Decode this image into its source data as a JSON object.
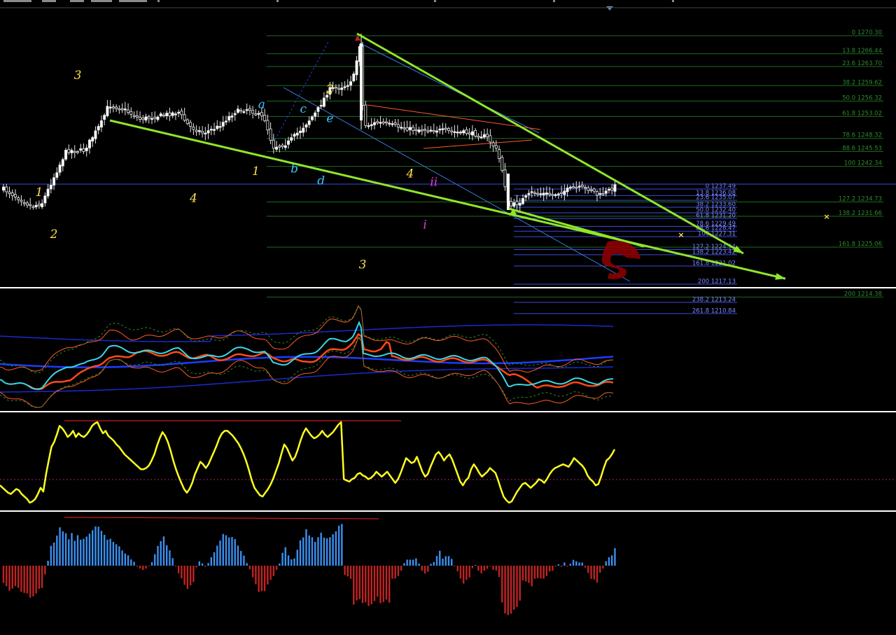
{
  "colors": {
    "background": "#000000",
    "fib_main": "#1f6b1f",
    "fib_main_text": "#2e8b2e",
    "fib_sub": "#3a4bd8",
    "fib_sub_text": "#7d86ff",
    "trend": "#8ee62a",
    "wave_yellow": "#ffe14a",
    "wave_cyan": "#3ec3ff",
    "wave_magenta": "#e03ce6",
    "bull_candle": "#ffffff",
    "bear_candle": "#000000",
    "wick": "#e8e8e8",
    "osc_line": "#ffff1e",
    "hist_up": "#3a8ff0",
    "hist_down": "#c02323",
    "divergence": "#ff2020",
    "marker": "#ffe14a"
  },
  "fib_main_levels": [
    {
      "label": "0 1270.30",
      "price": 1270.3
    },
    {
      "label": "13.8 1266.44",
      "price": 1266.44
    },
    {
      "label": "23.6 1263.70",
      "price": 1263.7
    },
    {
      "label": "38.2 1259.62",
      "price": 1259.62
    },
    {
      "label": "50.0 1256.32",
      "price": 1256.32
    },
    {
      "label": "61.8 1253.02",
      "price": 1253.02
    },
    {
      "label": "78.6 1248.32",
      "price": 1248.32
    },
    {
      "label": "88.6 1245.53",
      "price": 1245.53
    },
    {
      "label": "100 1242.34",
      "price": 1242.34
    },
    {
      "label": "127.2 1234.73",
      "price": 1234.73
    },
    {
      "label": "138.2 1231.66",
      "price": 1231.66
    },
    {
      "label": "161.8 1225.06",
      "price": 1225.06
    },
    {
      "label": "200 1214.38",
      "price": 1214.38
    }
  ],
  "fib_sub_levels": [
    {
      "label": "0 1237.49",
      "price": 1237.49
    },
    {
      "label": "13.8 1236.08",
      "price": 1236.08
    },
    {
      "label": "23.6 1235.07",
      "price": 1235.07
    },
    {
      "label": "38.2 1233.60",
      "price": 1233.6
    },
    {
      "label": "50.0 1232.40",
      "price": 1232.4
    },
    {
      "label": "61.8 1231.20",
      "price": 1231.2
    },
    {
      "label": "78.6 1229.49",
      "price": 1229.49
    },
    {
      "label": "88.6 1228.47",
      "price": 1228.47
    },
    {
      "label": "100 1227.31",
      "price": 1227.31
    },
    {
      "label": "127.2 1224.54",
      "price": 1224.54
    },
    {
      "label": "138.2 1223.42",
      "price": 1223.42
    },
    {
      "label": "161.8 1221.02",
      "price": 1221.02
    },
    {
      "label": "200 1217.13",
      "price": 1217.13
    },
    {
      "label": "238.2 1213.24",
      "price": 1213.24
    },
    {
      "label": "261.8 1210.84",
      "price": 1210.84
    }
  ],
  "wave_labels": [
    {
      "text": "1",
      "bar": 12,
      "price": 1236.0,
      "color": "wave_yellow"
    },
    {
      "text": "2",
      "bar": 17,
      "price": 1227.0,
      "color": "wave_yellow"
    },
    {
      "text": "3",
      "bar": 25,
      "price": 1261.0,
      "color": "wave_yellow"
    },
    {
      "text": "4",
      "bar": 64,
      "price": 1234.7,
      "color": "wave_yellow"
    },
    {
      "text": "5",
      "bar": 85,
      "price": 1278.0,
      "color": "wave_yellow"
    },
    {
      "text": "1",
      "bar": 85,
      "price": 1240.5,
      "color": "wave_yellow"
    },
    {
      "text": "2",
      "bar": 110,
      "price": 1258.0,
      "color": "wave_yellow"
    },
    {
      "text": "3",
      "bar": 121,
      "price": 1220.5,
      "color": "wave_yellow"
    },
    {
      "text": "4",
      "bar": 137,
      "price": 1240.0,
      "color": "wave_yellow"
    },
    {
      "text": "a",
      "bar": 87,
      "price": 1254.8,
      "color": "wave_cyan"
    },
    {
      "text": "b",
      "bar": 98,
      "price": 1241.0,
      "color": "wave_cyan"
    },
    {
      "text": "c",
      "bar": 101,
      "price": 1253.8,
      "color": "wave_cyan"
    },
    {
      "text": "d",
      "bar": 107,
      "price": 1238.5,
      "color": "wave_cyan"
    },
    {
      "text": "e",
      "bar": 110,
      "price": 1251.8,
      "color": "wave_cyan"
    },
    {
      "text": "ii",
      "bar": 145,
      "price": 1238.2,
      "color": "wave_magenta"
    },
    {
      "text": "i",
      "bar": 142,
      "price": 1229.0,
      "color": "wave_magenta"
    }
  ],
  "osc_values": [
    47,
    45,
    43,
    41,
    40,
    42,
    44,
    43,
    40,
    38,
    36,
    33,
    34,
    36,
    40,
    45,
    42,
    56,
    67,
    78,
    82,
    88,
    95,
    93,
    90,
    86,
    88,
    91,
    86,
    89,
    87,
    86,
    88,
    91,
    95,
    97,
    98,
    93,
    89,
    91,
    87,
    85,
    83,
    80,
    78,
    75,
    72,
    70,
    68,
    66,
    64,
    62,
    60,
    60,
    61,
    63,
    67,
    72,
    79,
    85,
    90,
    87,
    82,
    75,
    67,
    60,
    54,
    49,
    44,
    41,
    44,
    49,
    56,
    61,
    66,
    64,
    61,
    64,
    69,
    74,
    79,
    85,
    89,
    91,
    91,
    89,
    87,
    84,
    81,
    77,
    72,
    66,
    59,
    51,
    45,
    42,
    39,
    38,
    41,
    44,
    48,
    53,
    59,
    65,
    73,
    80,
    77,
    72,
    67,
    70,
    76,
    83,
    89,
    93,
    90,
    87,
    85,
    86,
    88,
    91,
    88,
    86,
    88,
    90,
    93,
    96,
    98,
    52,
    51,
    50,
    52,
    53,
    56,
    57,
    55,
    54,
    52,
    53,
    55,
    58,
    56,
    54,
    56,
    58,
    55,
    52,
    49,
    52,
    57,
    63,
    69,
    67,
    65,
    66,
    70,
    64,
    58,
    54,
    56,
    62,
    67,
    72,
    74,
    71,
    67,
    70,
    72,
    68,
    62,
    56,
    50,
    47,
    51,
    53,
    60,
    64,
    61,
    57,
    54,
    56,
    58,
    61,
    59,
    57,
    51,
    44,
    38,
    35,
    33,
    34,
    38,
    42,
    45,
    48,
    49,
    47,
    45,
    47,
    49,
    52,
    51,
    49,
    52,
    56,
    59,
    61,
    62,
    63,
    64,
    63,
    62,
    65,
    69,
    67,
    65,
    63,
    60,
    55,
    52,
    50,
    47,
    48,
    54,
    61,
    67,
    69,
    72,
    76
  ]
}
